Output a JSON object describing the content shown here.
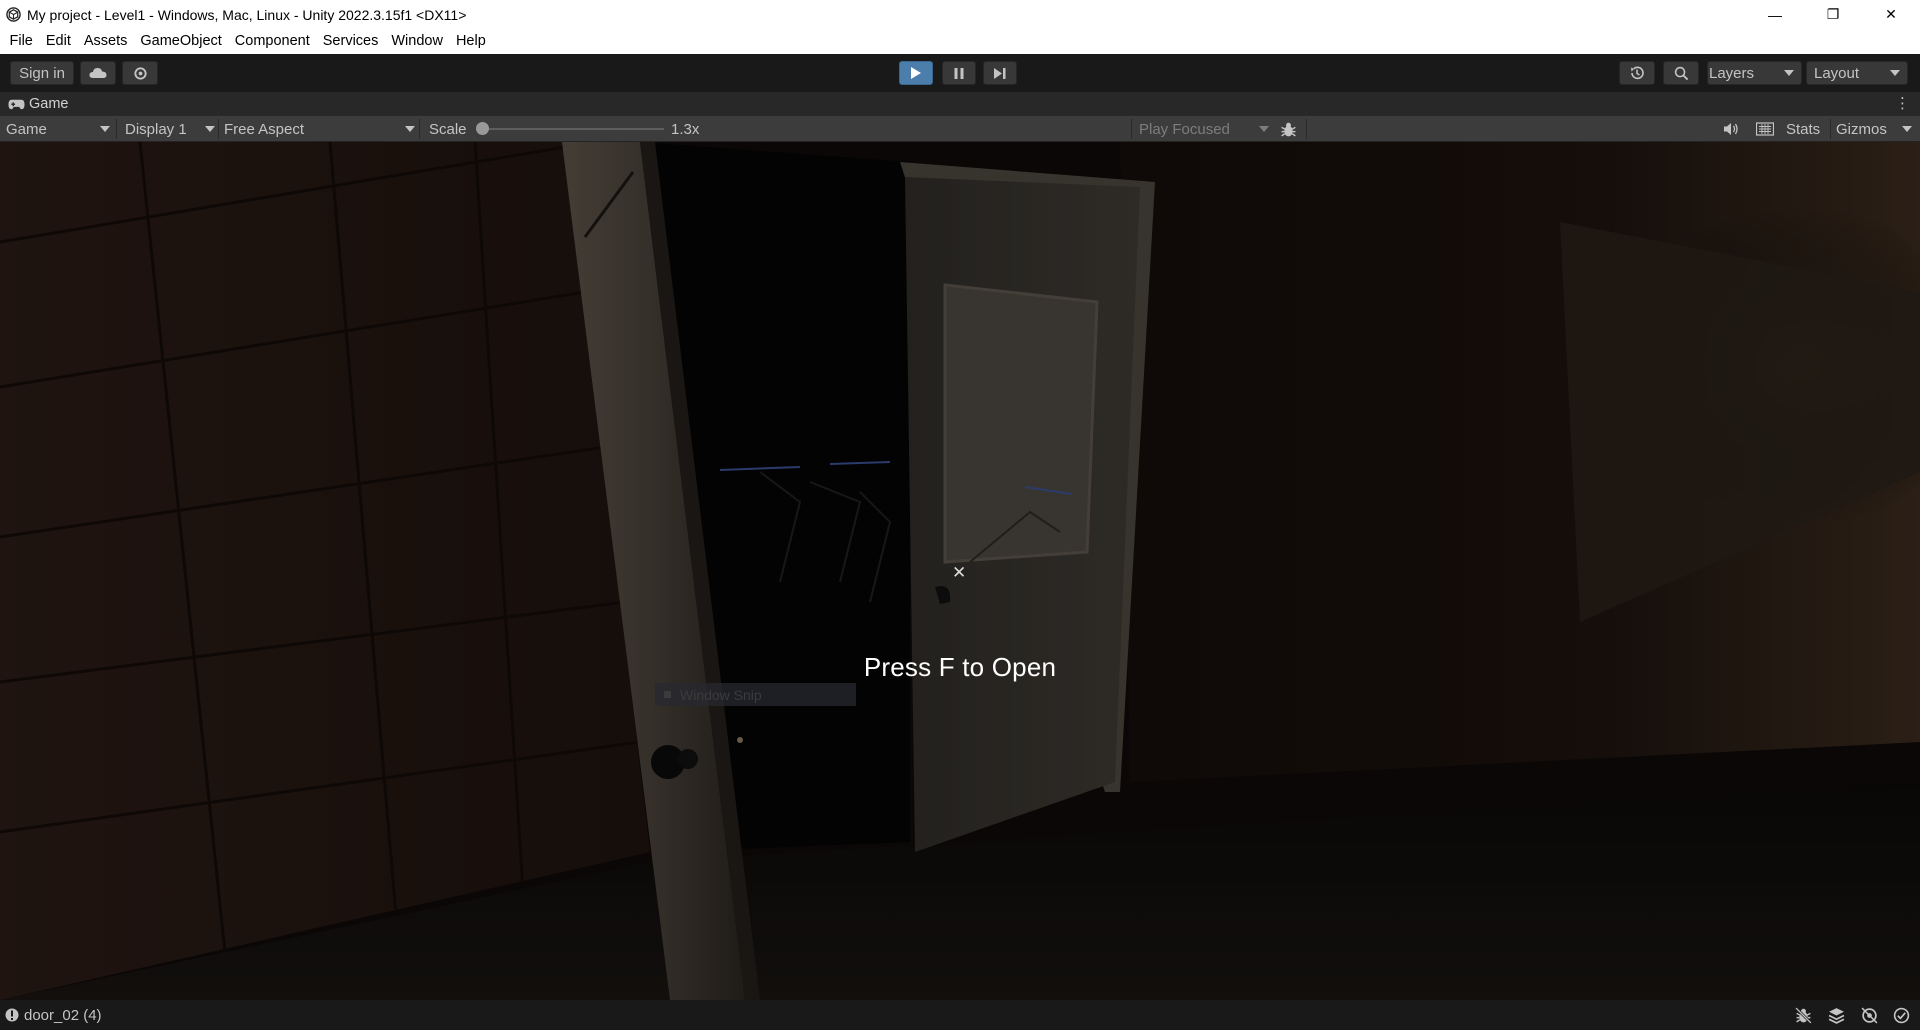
{
  "window": {
    "title": "My project - Level1 - Windows, Mac, Linux - Unity 2022.3.15f1 <DX11>",
    "controls": {
      "minimize": "—",
      "restore": "❐",
      "close": "✕"
    }
  },
  "menu": [
    "File",
    "Edit",
    "Assets",
    "GameObject",
    "Component",
    "Services",
    "Window",
    "Help"
  ],
  "toolbar": {
    "sign_in": "Sign in",
    "layers": "Layers",
    "layout": "Layout",
    "play_active": true
  },
  "tab": {
    "label": "Game"
  },
  "game_bar": {
    "view": "Game",
    "display": "Display 1",
    "aspect": "Free Aspect",
    "scale_label": "Scale",
    "scale_value": "1.3x",
    "play_focused": "Play Focused",
    "stats": "Stats",
    "gizmos": "Gizmos"
  },
  "game_view": {
    "prompt": "Press F to Open",
    "crosshair": "✕",
    "snip_label": "Window Snip"
  },
  "status": {
    "text": "door_02 (4)"
  },
  "colors": {
    "editor_bg": "#191919",
    "play_active": "#4c7eab",
    "prompt_text": "#ffffff"
  }
}
